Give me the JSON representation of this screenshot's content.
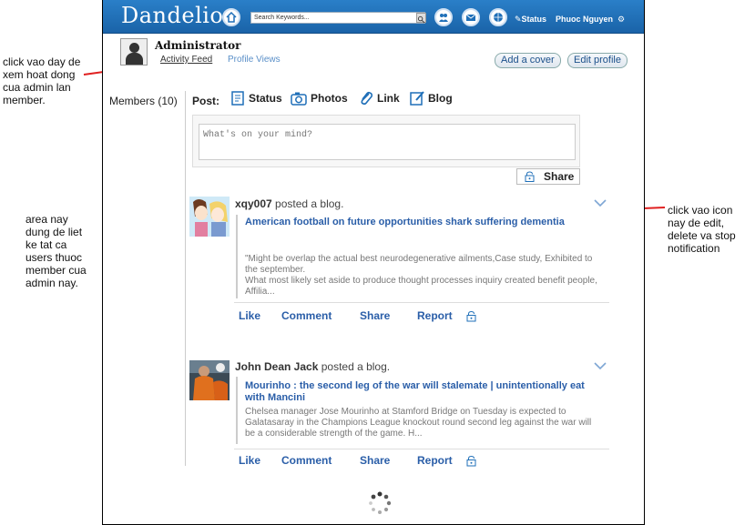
{
  "topbar": {
    "logo": "Dandelion",
    "search_placeholder": "Search Keywords...",
    "status_label": "Status",
    "user_name": "Phuoc Nguyen",
    "accent": "#1f6fb8"
  },
  "profile": {
    "name": "Administrator",
    "tab_activity": "Activity Feed",
    "tab_profile": "Profile Views",
    "add_cover": "Add a cover",
    "edit_profile": "Edit profile",
    "members_label": "Members (10)"
  },
  "composer": {
    "post_label": "Post:",
    "opt_status": "Status",
    "opt_photos": "Photos",
    "opt_link": "Link",
    "opt_blog": "Blog",
    "placeholder": "What's on your mind?",
    "share_label": "Share"
  },
  "feed": [
    {
      "author": "xqy007",
      "verb": "posted a blog.",
      "title": "American football on future opportunities shark suffering dementia",
      "body": "\"Might be overlap the actual best neurodegenerative ailments,Case study, Exhibited to the september.\nWhat most likely set aside to produce thought processes inquiry created benefit people, Affilia...",
      "like": "Like",
      "comment": "Comment",
      "share": "Share",
      "report": "Report"
    },
    {
      "author": "John Dean Jack",
      "verb": "posted a blog.",
      "title": "Mourinho : the second leg of the war will stalemate | unintentionally eat with Mancini",
      "body": "Chelsea manager Jose Mourinho at Stamford Bridge on Tuesday is expected to Galatasaray in the Champions League knockout round second leg against the war will be a considerable strength of the game.  H...",
      "like": "Like",
      "comment": "Comment",
      "share": "Share",
      "report": "Report"
    }
  ],
  "annotations": {
    "left_top": "click vao day de\nxem hoat dong\ncua admin lan\nmember.",
    "left_mid": "area nay\ndung de liet\nke tat ca\nusers thuoc\nmember cua\nadmin nay.",
    "right": "click vao icon\nnay de edit,\ndelete va stop\nnotification",
    "arrow_color": "#e02020"
  }
}
